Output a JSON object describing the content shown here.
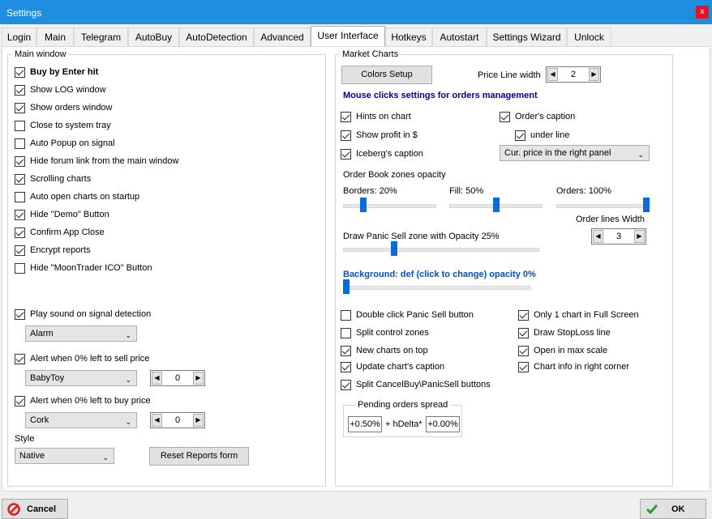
{
  "window": {
    "title": "Settings",
    "close_label": "x"
  },
  "tabs": [
    "Login",
    "Main",
    "Telegram",
    "AutoBuy",
    "AutoDetection",
    "Advanced",
    "User Interface",
    "Hotkeys",
    "Autostart",
    "Settings Wizard",
    "Unlock"
  ],
  "active_tab": "User Interface",
  "main_window": {
    "legend": "Main window",
    "items": [
      {
        "label": "Buy by Enter hit",
        "checked": true
      },
      {
        "label": "Show LOG window",
        "checked": true
      },
      {
        "label": "Show orders window",
        "checked": true
      },
      {
        "label": "Close to system tray",
        "checked": false
      },
      {
        "label": "Auto Popup on signal",
        "checked": false
      },
      {
        "label": "Hide forum link from the main window",
        "checked": true
      },
      {
        "label": "Scrolling charts",
        "checked": true
      },
      {
        "label": "Auto open charts on startup",
        "checked": false
      },
      {
        "label": "Hide \"Demo\" Button",
        "checked": true
      },
      {
        "label": "Confirm App Close",
        "checked": true
      },
      {
        "label": "Encrypt reports",
        "checked": true
      },
      {
        "label": "Hide \"MoonTrader ICO\" Button",
        "checked": false
      }
    ],
    "play_sound": {
      "label": "Play sound on signal detection",
      "checked": true
    },
    "sound_select": "Alarm",
    "alert_sell": {
      "label": "Alert when 0% left to sell price",
      "checked": true
    },
    "sell_select": "BabyToy",
    "sell_spin": "0",
    "alert_buy": {
      "label": "Alert when 0% left to buy price",
      "checked": true
    },
    "buy_select": "Cork",
    "buy_spin": "0",
    "style_label": "Style",
    "style_select": "Native",
    "reset_button": "Reset Reports form"
  },
  "market_charts": {
    "legend": "Market Charts",
    "colors_button": "Colors Setup",
    "price_line_label": "Price Line width",
    "price_line_value": "2",
    "mouse_heading": "Mouse clicks settings for orders management",
    "hints": {
      "label": "Hints on chart",
      "checked": true
    },
    "show_profit": {
      "label": "Show profit in $",
      "checked": true
    },
    "iceberg": {
      "label": "Iceberg's caption",
      "checked": true
    },
    "order_caption": {
      "label": "Order's caption",
      "checked": true
    },
    "under_line": {
      "label": "under line",
      "checked": true
    },
    "price_select": "Cur. price in the right panel",
    "ob_label": "Order Book zones opacity",
    "borders_label": "Borders: 20%",
    "borders_value": 0.2,
    "fill_label": "Fill: 50%",
    "fill_value": 0.5,
    "orders_label": "Orders: 100%",
    "orders_value": 1.0,
    "order_lines_label": "Order lines Width",
    "order_lines_value": "3",
    "panic_label": "Draw Panic Sell zone with Opacity 25%",
    "panic_value": 0.25,
    "background_label": "Background: def (click to change) opacity 0%",
    "background_value": 0.0,
    "left_checks": [
      {
        "label": "Double click Panic Sell button",
        "checked": false
      },
      {
        "label": "Split control zones",
        "checked": false
      },
      {
        "label": "New charts on top",
        "checked": true
      },
      {
        "label": "Update chart's caption",
        "checked": true
      },
      {
        "label": "Split CancelBuy\\PanicSell buttons",
        "checked": true
      }
    ],
    "right_checks": [
      {
        "label": "Only 1 chart in Full Screen",
        "checked": true
      },
      {
        "label": "Draw StopLoss line",
        "checked": true
      },
      {
        "label": "Open in max scale",
        "checked": true
      },
      {
        "label": "Chart info in right corner",
        "checked": true
      }
    ],
    "pending_legend": "Pending orders spread",
    "pending_a": "+0.50%",
    "pending_mid": "+ hDelta*",
    "pending_b": "+0.00%"
  },
  "footer": {
    "cancel": "Cancel",
    "ok": "OK"
  },
  "colors": {
    "accent": "#1e8fe0",
    "slider": "#0a6cd6",
    "heading": "#000090"
  }
}
